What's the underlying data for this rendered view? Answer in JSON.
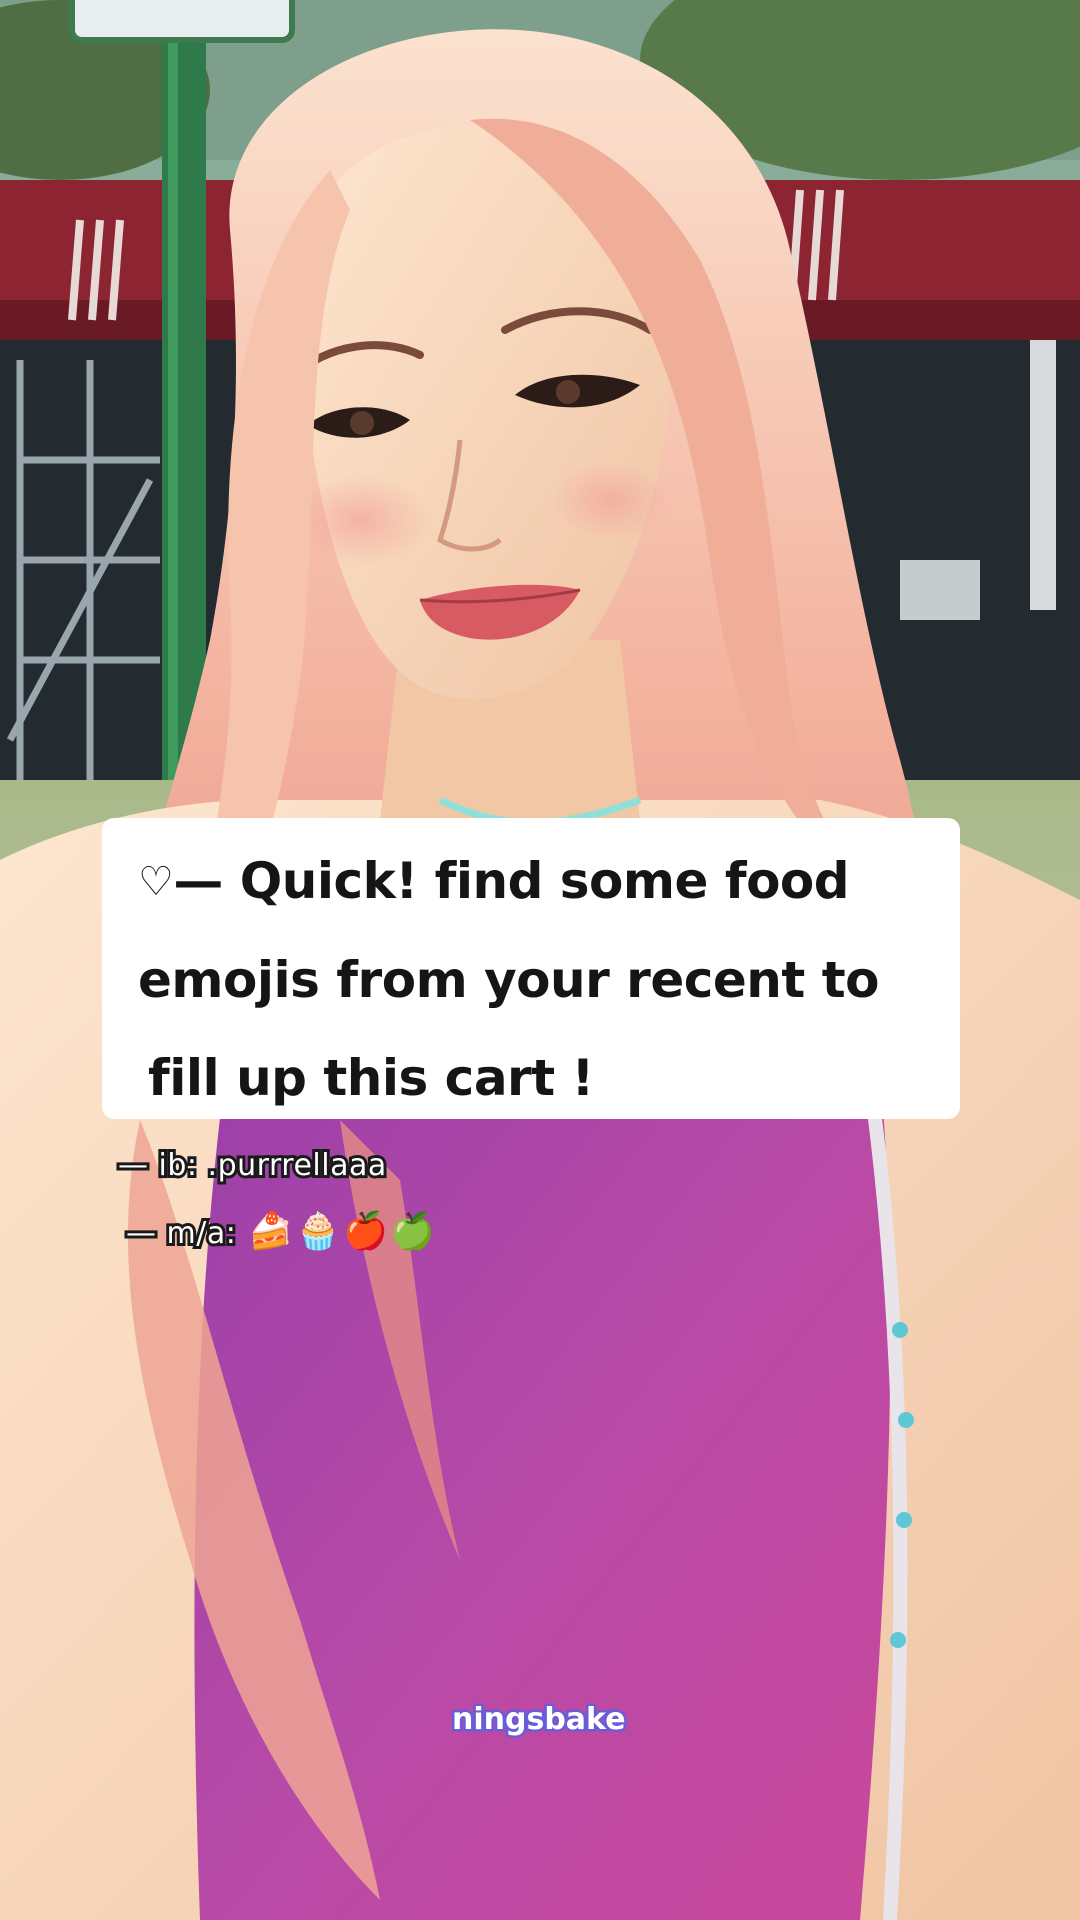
{
  "caption": {
    "line1_icon": "♡",
    "line1_text": "— Quick! find some food",
    "line2_text": "emojis from your recent to",
    "line3_text": "fill up this cart !"
  },
  "credits": {
    "ib": "— ib: .purrrellaaa",
    "ma_label": "— m/a:",
    "ma_emojis": [
      "🍰",
      "🧁",
      "🍎",
      "🍏"
    ]
  },
  "watermark": "ningsbake",
  "colors": {
    "caption_bg": "#ffffff",
    "caption_text": "#151515",
    "top_purple": "#b5489e",
    "hair_pink": "#f2b3a4",
    "watermark_outline": "#6a5cd8"
  }
}
